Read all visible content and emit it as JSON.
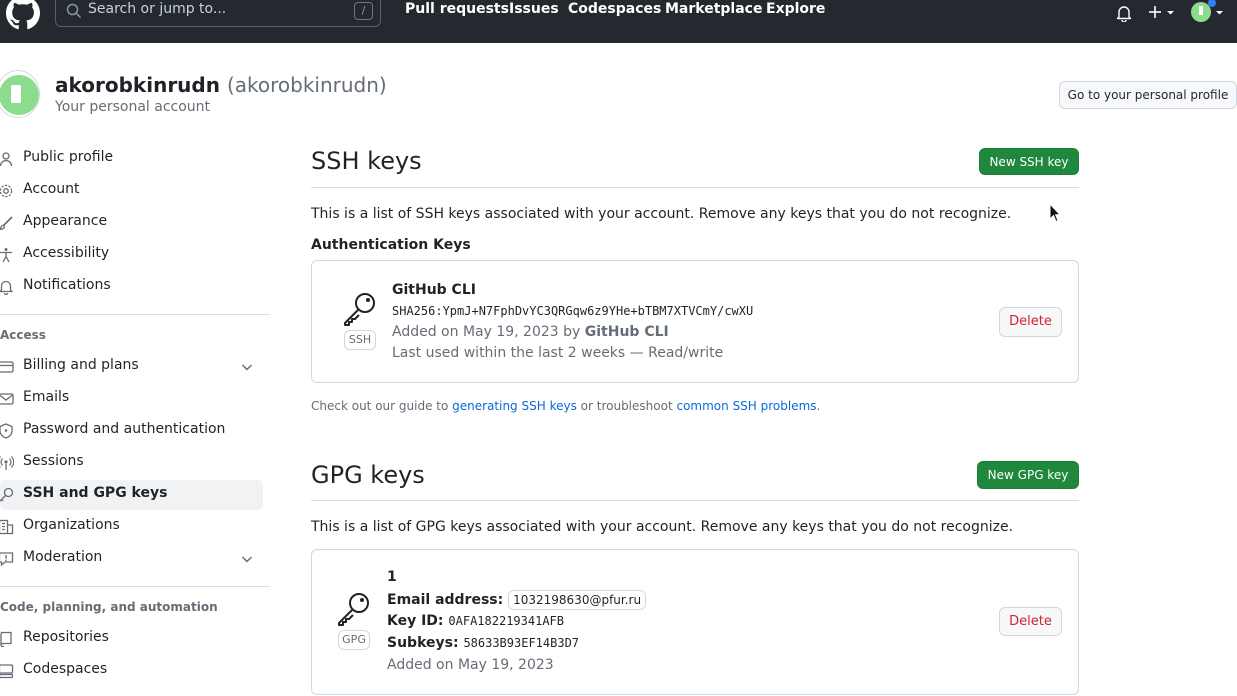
{
  "header": {
    "search_placeholder": "Search or jump to...",
    "search_shortcut": "/",
    "nav": [
      "Pull requests",
      "Issues",
      "Codespaces",
      "Marketplace",
      "Explore"
    ]
  },
  "profile": {
    "display_name": "akorobkinrudn",
    "login": "(akorobkinrudn)",
    "subtitle": "Your personal account",
    "go_to_profile": "Go to your personal profile"
  },
  "sidebar": {
    "items_top": [
      {
        "label": "Public profile",
        "icon": "person-icon"
      },
      {
        "label": "Account",
        "icon": "gear-icon"
      },
      {
        "label": "Appearance",
        "icon": "paintbrush-icon"
      },
      {
        "label": "Accessibility",
        "icon": "accessibility-icon"
      },
      {
        "label": "Notifications",
        "icon": "bell-icon"
      }
    ],
    "section_access": "Access",
    "items_access": [
      {
        "label": "Billing and plans",
        "icon": "credit-card-icon"
      },
      {
        "label": "Emails",
        "icon": "mail-icon"
      },
      {
        "label": "Password and authentication",
        "icon": "shield-icon"
      },
      {
        "label": "Sessions",
        "icon": "broadcast-icon"
      },
      {
        "label": "SSH and GPG keys",
        "icon": "key-icon"
      },
      {
        "label": "Organizations",
        "icon": "organization-icon"
      },
      {
        "label": "Moderation",
        "icon": "report-icon"
      }
    ],
    "section_code": "Code, planning, and automation",
    "items_code": [
      {
        "label": "Repositories",
        "icon": "repo-icon"
      },
      {
        "label": "Codespaces",
        "icon": "codespaces-icon"
      }
    ]
  },
  "ssh": {
    "title": "SSH keys",
    "new_button": "New SSH key",
    "description": "This is a list of SSH keys associated with your account. Remove any keys that you do not recognize.",
    "auth_heading": "Authentication Keys",
    "key": {
      "badge": "SSH",
      "title": "GitHub CLI",
      "fingerprint": "SHA256:YpmJ+N7FphDvYC3QRGqw6z9YHe+bTBM7XTVCmY/cwXU",
      "added_prefix": "Added on May 19, 2023 by",
      "added_by": "GitHub CLI",
      "last_used": "Last used within the last 2 weeks — Read/write",
      "delete": "Delete"
    },
    "note_prefix": "Check out our guide to",
    "note_link1": "generating SSH keys",
    "note_mid": "or troubleshoot",
    "note_link2": "common SSH problems",
    "note_suffix": "."
  },
  "gpg": {
    "title": "GPG keys",
    "new_button": "New GPG key",
    "description": "This is a list of GPG keys associated with your account. Remove any keys that you do not recognize.",
    "key": {
      "badge": "GPG",
      "title": "1",
      "email_label": "Email address:",
      "email": "1032198630@pfur.ru",
      "keyid_label": "Key ID:",
      "keyid": "0AFA182219341AFB",
      "subkeys_label": "Subkeys:",
      "subkeys": "58633B93EF14B3D7",
      "added": "Added on May 19, 2023",
      "delete": "Delete"
    }
  }
}
